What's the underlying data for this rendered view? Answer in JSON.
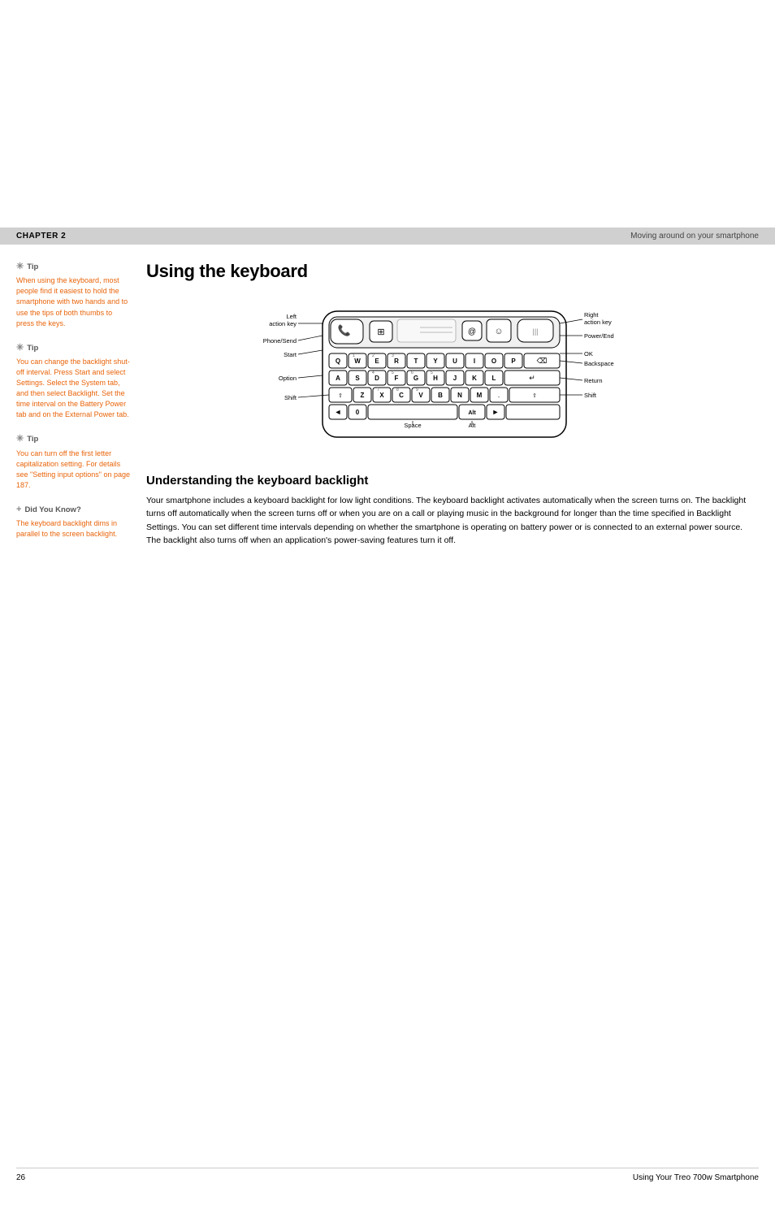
{
  "chapter": {
    "label": "CHAPTER 2",
    "title": "Moving around on your smartphone"
  },
  "section": {
    "title": "Using the keyboard",
    "subsection_title": "Understanding the keyboard backlight",
    "body_text": "Your smartphone includes a keyboard backlight for low light conditions. The keyboard backlight activates automatically when the screen turns on. The backlight turns off automatically when the screen turns off or when you are on a call or playing music in the background for longer than the time specified in Backlight Settings. You can set different time intervals depending on whether the smartphone is operating on battery power or is connected to an external power source. The backlight also turns off when an application's power-saving features turn it off."
  },
  "tips": [
    {
      "type": "tip",
      "text": "When using the keyboard, most people find it easiest to hold the smartphone with two hands and to use the tips of both thumbs to press the keys."
    },
    {
      "type": "tip",
      "text": "You can change the backlight shut-off interval. Press Start and select Settings. Select the System tab, and then select Backlight. Set the time interval on the Battery Power tab and on the External Power tab."
    },
    {
      "type": "tip",
      "text": "You can turn off the first letter capitalization setting. For details see \"Setting input options\" on page 187."
    },
    {
      "type": "did_you_know",
      "text": "The keyboard backlight dims in parallel to the screen backlight."
    }
  ],
  "keyboard": {
    "labels": {
      "left_action_key": "Left\naction key",
      "phone_send": "Phone/Send",
      "start": "Start",
      "option": "Option",
      "shift_left": "Shift",
      "space": "Space",
      "alt_bottom": "Alt",
      "right_action_key": "Right\naction key",
      "power_end": "Power/End",
      "ok": "OK",
      "backspace": "Backspace",
      "return": "Return",
      "shift_right": "Shift"
    },
    "rows": [
      [
        "Q",
        "W",
        "E",
        "R",
        "T",
        "Y",
        "U",
        "I",
        "O",
        "P"
      ],
      [
        "A",
        "S",
        "D",
        "F",
        "G",
        "H",
        "J",
        "K",
        "L",
        ""
      ],
      [
        "Z",
        "X",
        "C",
        "V",
        "B",
        "N",
        "M",
        ".",
        "",
        ""
      ]
    ]
  },
  "footer": {
    "page_number": "26",
    "title": "Using Your Treo 700w Smartphone"
  }
}
